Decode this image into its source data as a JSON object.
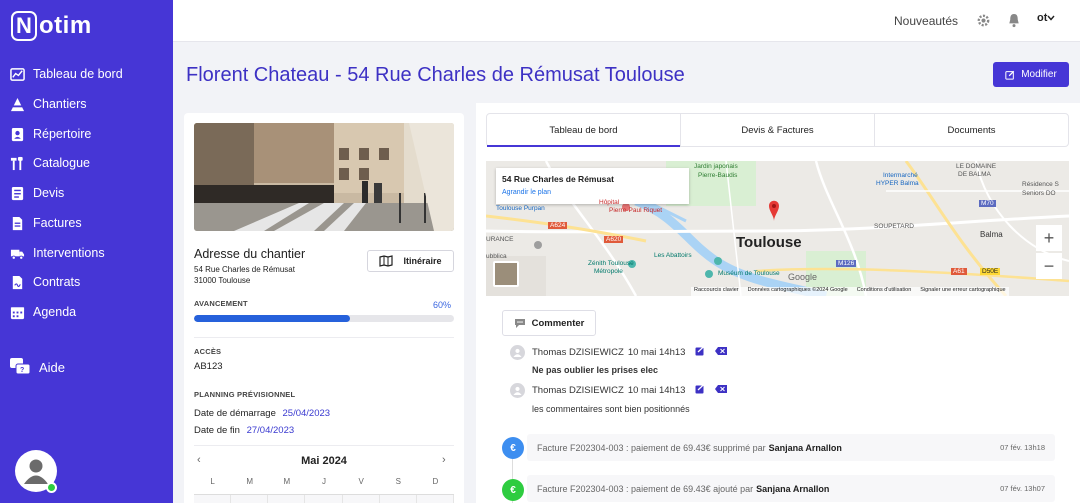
{
  "app": {
    "logo_letter": "N",
    "logo_text": "otim"
  },
  "sidebar": {
    "items": [
      {
        "label": "Tableau de bord",
        "icon": "dashboard-icon"
      },
      {
        "label": "Chantiers",
        "icon": "construction-icon"
      },
      {
        "label": "Répertoire",
        "icon": "contacts-icon"
      },
      {
        "label": "Catalogue",
        "icon": "tools-icon"
      },
      {
        "label": "Devis",
        "icon": "quote-icon"
      },
      {
        "label": "Factures",
        "icon": "invoice-icon"
      },
      {
        "label": "Interventions",
        "icon": "truck-icon"
      },
      {
        "label": "Contrats",
        "icon": "contract-icon"
      },
      {
        "label": "Agenda",
        "icon": "calendar-icon"
      }
    ],
    "help_label": "Aide"
  },
  "topbar": {
    "news_label": "Nouveautés",
    "user_initials": "ot"
  },
  "page": {
    "title": "Florent Chateau - 54 Rue Charles de Rémusat Toulouse",
    "edit_label": "Modifier"
  },
  "site": {
    "address_title": "Adresse du chantier",
    "address_line1": "54 Rue Charles de Rémusat",
    "address_line2": "31000 Toulouse",
    "route_label": "Itinéraire",
    "progress_label": "AVANCEMENT",
    "progress_text": "60%",
    "progress_value": 0.6,
    "access_label": "ACCÈS",
    "access_value": "AB123",
    "planning_label": "PLANNING PRÉVISIONNEL",
    "start_label": "Date de démarrage",
    "start_value": "25/04/2023",
    "end_label": "Date de fin",
    "end_value": "27/04/2023"
  },
  "calendar": {
    "month": "Mai 2024",
    "days": [
      "L",
      "M",
      "M",
      "J",
      "V",
      "S",
      "D"
    ]
  },
  "tabs": [
    {
      "label": "Tableau de bord"
    },
    {
      "label": "Devis & Factures"
    },
    {
      "label": "Documents"
    }
  ],
  "map": {
    "popup_title": "54 Rue Charles de Rémusat",
    "popup_link": "Agrandir le plan",
    "city": "Toulouse",
    "labels": {
      "jardin": "Jardin japonais",
      "pierre_baudis": "Pierre-Baudis",
      "le_domaine": "LE DOMAINE",
      "de_balma": "DE BALMA",
      "intermarche": "Intermarché",
      "hyper_balma": "HYPER Balma",
      "residence": "Résidence S",
      "seniors": "Seniors DO",
      "toulouse_purpan": "Toulouse Purpan",
      "hopital": "Hôpital",
      "pierre_paul": "Pierre-Paul Riquet",
      "soupetard": "SOUPETARD",
      "balma": "Balma",
      "urance": "URANCE",
      "ubblica": "ubblica",
      "zenith": "Zénith Toulouse",
      "metropole": "Métropole",
      "abattoirs": "Les Abattoirs",
      "museum": "Muséum de Toulouse",
      "a624": "A624",
      "a620": "A620",
      "m126": "M126",
      "m70": "M70",
      "a61": "A61",
      "d50e": "D50E",
      "google": "Google"
    },
    "footer": [
      "Raccourcis clavier",
      "Données cartographiques ©2024 Google",
      "Conditions d'utilisation",
      "Signaler une erreur cartographique"
    ],
    "zoom_in": "+",
    "zoom_out": "−"
  },
  "comments": {
    "button_label": "Commenter",
    "items": [
      {
        "author": "Thomas DZISIEWICZ",
        "date": "10 mai 14h13",
        "text": "Ne pas oublier les prises elec"
      },
      {
        "author": "Thomas DZISIEWICZ",
        "date": "10 mai 14h13",
        "text": "les commentaires sont bien positionnés"
      }
    ]
  },
  "timeline": [
    {
      "icon": "euro-icon",
      "text": "Facture F202304-003 : paiement de 69.43€ supprimé par",
      "user": "Sanjana Arnallon",
      "time": "07 fév. 13h18",
      "color": "#3d8ef0"
    },
    {
      "icon": "euro-icon",
      "text": "Facture F202304-003 : paiement de 69.43€ ajouté par",
      "user": "Sanjana Arnallon",
      "time": "07 fév. 13h07",
      "color": "#2ecc40"
    }
  ],
  "colors": {
    "brand": "#4636d6",
    "title": "#3d31c4",
    "progress": "#2661db"
  }
}
